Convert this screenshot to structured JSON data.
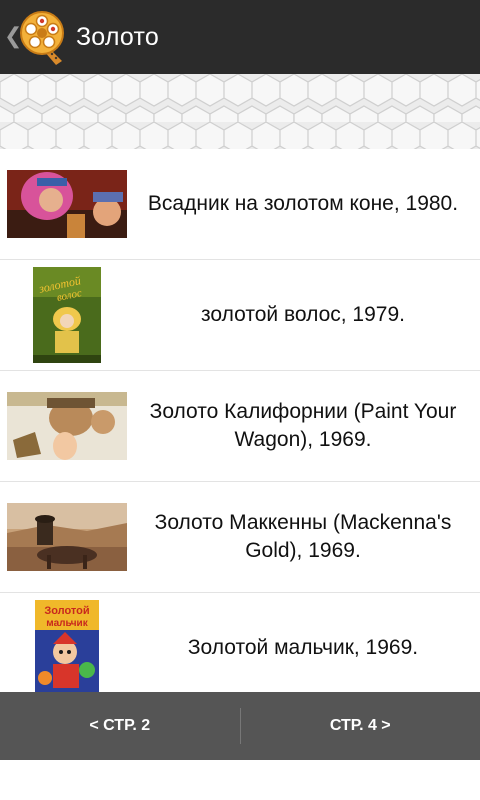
{
  "header": {
    "title": "Золото",
    "back_icon": "back-chevron-icon",
    "logo_icon": "film-reel-logo-icon"
  },
  "list": {
    "items": [
      {
        "title": "Всадник на золотом коне, 1980.",
        "thumb_icon": "movie-poster-rider-icon"
      },
      {
        "title": "золотой волос, 1979.",
        "thumb_icon": "movie-poster-golden-hair-icon"
      },
      {
        "title": "Золото Калифорнии (Paint Your Wagon), 1969.",
        "thumb_icon": "movie-poster-paint-your-wagon-icon"
      },
      {
        "title": "Золото Маккенны (Mackenna's Gold), 1969.",
        "thumb_icon": "movie-still-mackennas-gold-icon"
      },
      {
        "title": "Золотой мальчик, 1969.",
        "thumb_icon": "movie-poster-golden-boy-icon",
        "poster_text": "Золотой мальчик"
      }
    ]
  },
  "footer": {
    "prev_label": "< СТР. 2",
    "next_label": "СТР. 4 >"
  },
  "colors": {
    "actionbar_bg": "#2b2b2b",
    "footer_bg": "#555555",
    "banner_bg": "#ececec",
    "row_divider": "#e3e3e3"
  }
}
